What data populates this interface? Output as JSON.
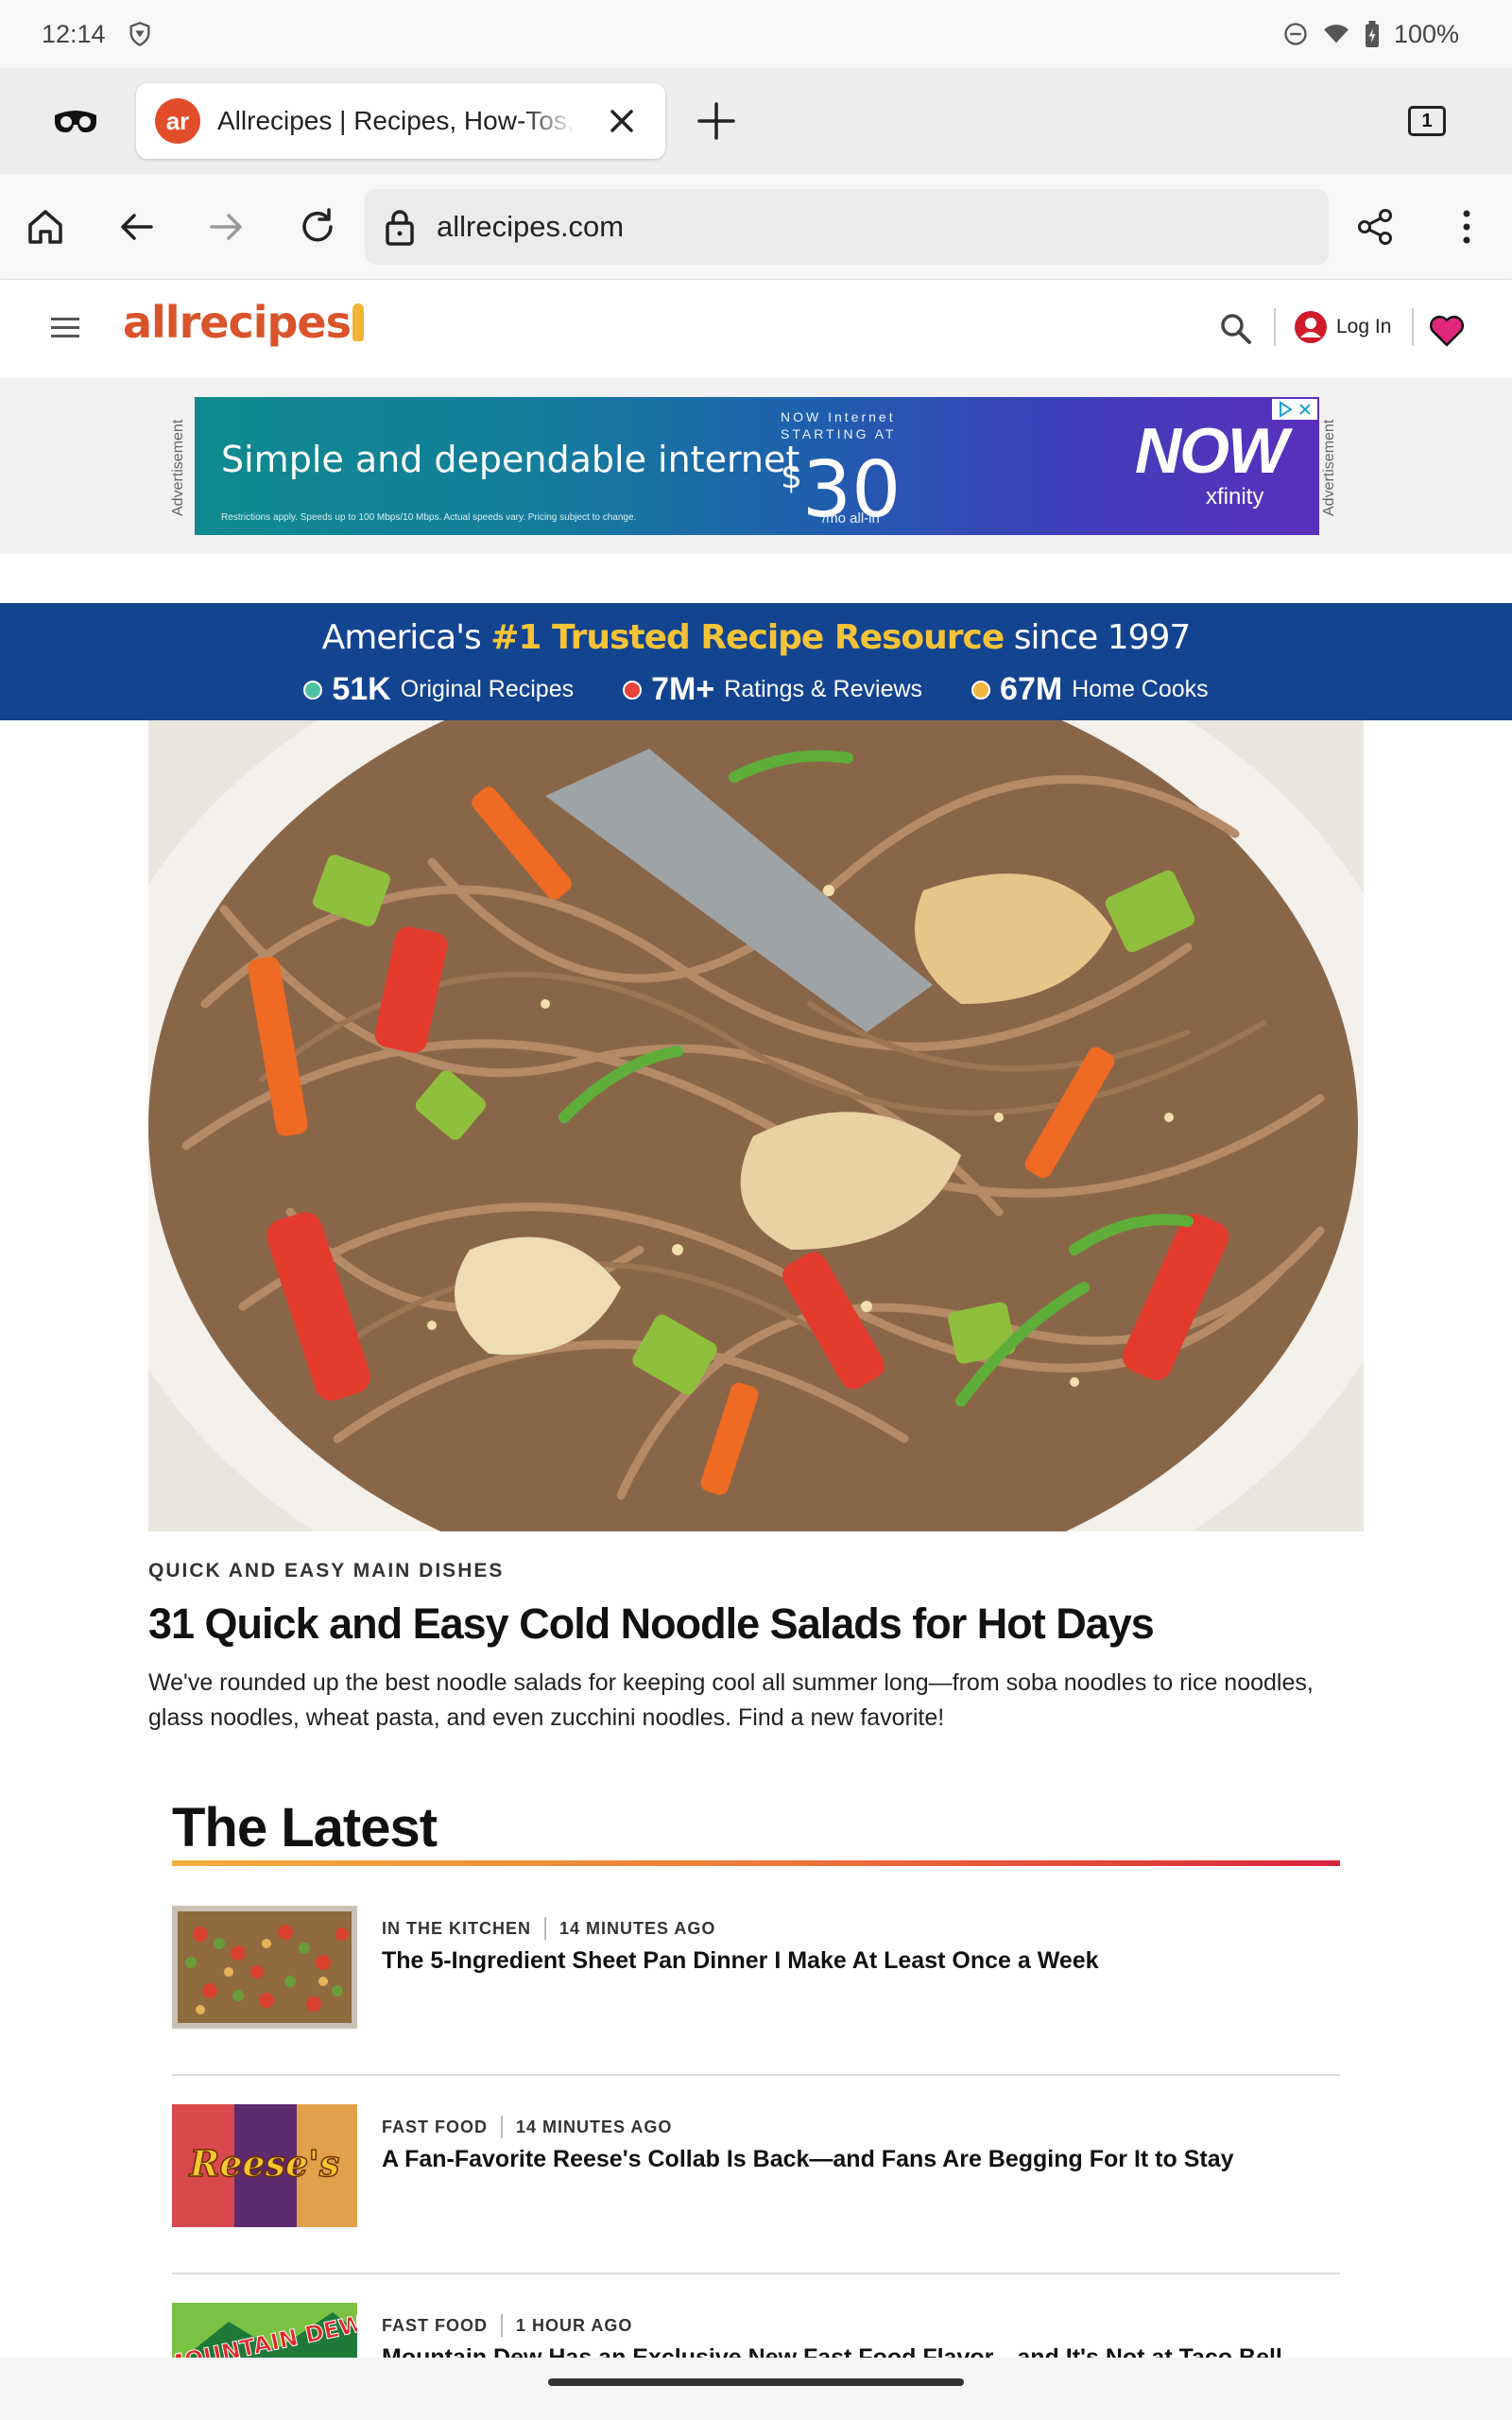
{
  "status_bar": {
    "time": "12:14",
    "battery": "100%"
  },
  "browser": {
    "tab_title": "Allrecipes | Recipes, How-Tos,",
    "tab_favicon": "ar",
    "tab_count": "1",
    "url": "allrecipes.com"
  },
  "site": {
    "logo": "allrecipes",
    "login_label": "Log In"
  },
  "ad": {
    "label": "Advertisement",
    "headline": "Simple and dependable internet",
    "fine_print": "Restrictions apply. Speeds up to 100 Mbps/10 Mbps. Actual speeds vary. Pricing subject to change.",
    "offer_line1": "NOW Internet",
    "offer_line2": "STARTING AT",
    "price_symbol": "$",
    "price": "30",
    "price_unit": "/mo all-in",
    "brand": "NOW",
    "sub_brand": "xfinity"
  },
  "trust": {
    "prefix": "America's ",
    "highlight": "#1 Trusted Recipe Resource",
    "suffix": " since 1997",
    "stats": [
      {
        "number": "51K",
        "label": "Original Recipes",
        "color": "#4fc3a1"
      },
      {
        "number": "7M+",
        "label": "Ratings & Reviews",
        "color": "#e8433a"
      },
      {
        "number": "67M",
        "label": "Home Cooks",
        "color": "#f2b441"
      }
    ]
  },
  "hero": {
    "category": "QUICK AND EASY MAIN DISHES",
    "title": "31 Quick and Easy Cold Noodle Salads for Hot Days",
    "description": "We've rounded up the best noodle salads for keeping cool all summer long—from soba noodles to rice noodles, glass noodles, wheat pasta, and even zucchini noodles. Find a new favorite!"
  },
  "latest": {
    "heading": "The Latest",
    "articles": [
      {
        "category": "IN THE KITCHEN",
        "time": "14 MINUTES AGO",
        "title": "The 5-Ingredient Sheet Pan Dinner I Make At Least Once a Week"
      },
      {
        "category": "FAST FOOD",
        "time": "14 MINUTES AGO",
        "title": "A Fan-Favorite Reese's Collab Is Back—and Fans Are Begging For It to Stay",
        "thumb_text": "Reese's"
      },
      {
        "category": "FAST FOOD",
        "time": "1 HOUR AGO",
        "title": "Mountain Dew Has an Exclusive New Fast Food Flavor—and It's Not at Taco Bell",
        "thumb_text": "MOUNTAIN DEW"
      }
    ]
  },
  "colors": {
    "brand_orange": "#d9532b",
    "trust_blue": "#134490",
    "highlight_yellow": "#f5c338"
  }
}
